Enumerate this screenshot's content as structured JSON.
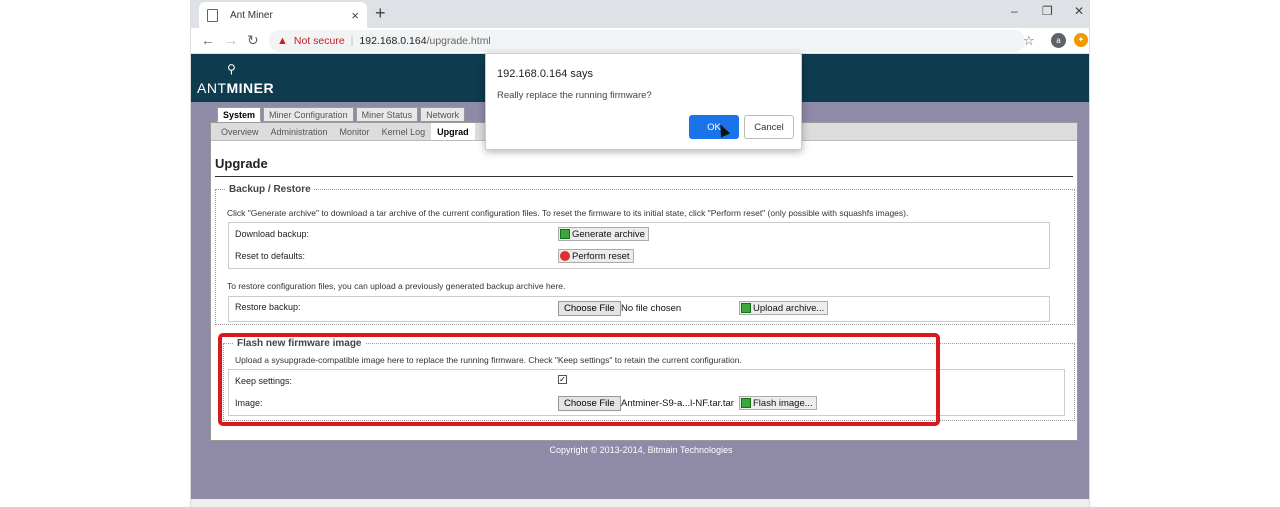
{
  "browser": {
    "tab_title": "Ant Miner",
    "tab_close": "×",
    "new_tab": "+",
    "win_min": "–",
    "win_max": "❐",
    "win_close": "✕",
    "back": "←",
    "forward": "→",
    "reload": "↻",
    "warning_glyph": "▲",
    "security_label": "Not secure",
    "url_sep": "|",
    "url_host": "192.168.0.164",
    "url_path": "/upgrade.html",
    "star": "☆",
    "avatar_letter": "a"
  },
  "header": {
    "logo_thin": "ANT",
    "logo_bold": "MINER"
  },
  "main_tabs": [
    "System",
    "Miner Configuration",
    "Miner Status",
    "Network"
  ],
  "sub_tabs": [
    "Overview",
    "Administration",
    "Monitor",
    "Kernel Log",
    "Upgrad"
  ],
  "page": {
    "title": "Upgrade",
    "backup": {
      "legend": "Backup / Restore",
      "desc": "Click \"Generate archive\" to download a tar archive of the current configuration files. To reset the firmware to its initial state, click \"Perform reset\" (only possible with squashfs images).",
      "download_label": "Download backup:",
      "generate_btn": "Generate archive",
      "reset_label": "Reset to defaults:",
      "reset_btn": "Perform reset",
      "restore_desc": "To restore configuration files, you can upload a previously generated backup archive here.",
      "restore_label": "Restore backup:",
      "choose_file": "Choose File",
      "no_file": "No file chosen",
      "upload_btn": "Upload archive..."
    },
    "flash": {
      "legend": "Flash new firmware image",
      "desc": "Upload a sysupgrade-compatible image here to replace the running firmware. Check \"Keep settings\" to retain the current configuration.",
      "keep_label": "Keep settings:",
      "keep_checked": "✓",
      "image_label": "Image:",
      "choose_file": "Choose File",
      "file_name": "Antminer-S9-a...l-NF.tar.tar",
      "flash_btn": "Flash image..."
    }
  },
  "footer": {
    "copyright": "Copyright © 2013-2014, Bitmain Technologies"
  },
  "dialog": {
    "title": "192.168.0.164 says",
    "message": "Really replace the running firmware?",
    "ok": "OK",
    "cancel": "Cancel"
  },
  "colors": {
    "header_bg": "#0f3b4f",
    "page_bg": "#8f8aa8",
    "highlight": "#d71920",
    "ok_button": "#1a73e8"
  }
}
